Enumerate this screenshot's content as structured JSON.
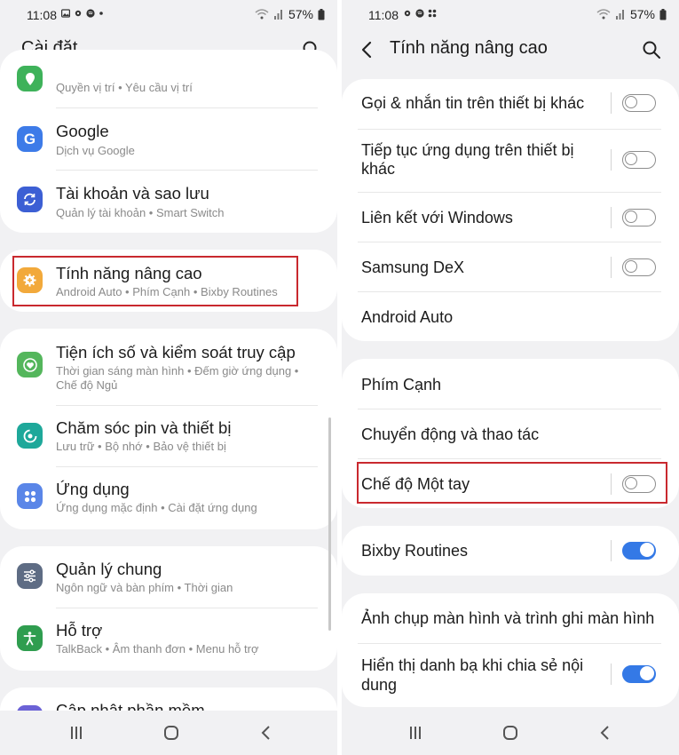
{
  "status_bar": {
    "left_time": "11:08",
    "right_time": "11:08",
    "battery": "57%"
  },
  "left": {
    "header_title": "Cài đặt",
    "cards": [
      {
        "rows": [
          {
            "title": "",
            "subtitle": "Quyền vị trí  •  Yêu cầu vị trí",
            "icon": "location-icon",
            "color": "#3eb25a"
          },
          {
            "title": "Google",
            "subtitle": "Dịch vụ Google",
            "icon": "google-icon",
            "color": "#3d7be8"
          },
          {
            "title": "Tài khoản và sao lưu",
            "subtitle": "Quản lý tài khoản  •  Smart Switch",
            "icon": "sync-icon",
            "color": "#3c5fd4"
          }
        ]
      },
      {
        "rows": [
          {
            "title": "Tính năng nâng cao",
            "subtitle": "Android Auto  •  Phím Cạnh  •  Bixby Routines",
            "icon": "gear-plus-icon",
            "color": "#f2a93b"
          }
        ]
      },
      {
        "rows": [
          {
            "title": "Tiện ích số và kiểm soát truy cập",
            "subtitle": "Thời gian sáng màn hình  •  Đếm giờ ứng dụng  •",
            "subtitle2": "Chế độ Ngủ",
            "icon": "heart-circle-icon",
            "color": "#54b65c"
          },
          {
            "title": "Chăm sóc pin và thiết bị",
            "subtitle": "Lưu trữ  •  Bộ nhớ  •  Bảo vệ thiết bị",
            "icon": "device-care-icon",
            "color": "#1ea89a"
          },
          {
            "title": "Ứng dụng",
            "subtitle": "Ứng dụng mặc định  •  Cài đặt ứng dụng",
            "icon": "apps-icon",
            "color": "#5a86e8"
          }
        ]
      },
      {
        "rows": [
          {
            "title": "Quản lý chung",
            "subtitle": "Ngôn ngữ và bàn phím  •  Thời gian",
            "icon": "sliders-icon",
            "color": "#5e6c84"
          },
          {
            "title": "Hỗ trợ",
            "subtitle": "TalkBack  •  Âm thanh đơn  •  Menu hỗ trợ",
            "icon": "accessibility-icon",
            "color": "#2f9d4f"
          }
        ]
      },
      {
        "rows": [
          {
            "title": "Cập nhật phần mềm",
            "subtitle": "",
            "icon": "update-icon",
            "color": "#6b62d6"
          }
        ]
      }
    ]
  },
  "right": {
    "header_title": "Tính năng nâng cao",
    "cards": [
      {
        "rows": [
          {
            "title": "Gọi & nhắn tin trên thiết bị khác",
            "toggle": "off"
          },
          {
            "title": "Tiếp tục ứng dụng trên thiết bị",
            "title2": "khác",
            "toggle": "off"
          },
          {
            "title": "Liên kết với Windows",
            "toggle": "off"
          },
          {
            "title": "Samsung DeX",
            "toggle": "off"
          },
          {
            "title": "Android Auto",
            "toggle": "none"
          }
        ]
      },
      {
        "rows": [
          {
            "title": "Phím Cạnh",
            "toggle": "none"
          },
          {
            "title": "Chuyển động và thao tác",
            "toggle": "none"
          },
          {
            "title": "Chế độ Một tay",
            "toggle": "off"
          }
        ]
      },
      {
        "rows": [
          {
            "title": "Bixby Routines",
            "toggle": "on"
          }
        ]
      },
      {
        "rows": [
          {
            "title": "Ảnh chụp màn hình và trình ghi màn hình",
            "toggle": "none"
          },
          {
            "title": "Hiển thị danh bạ khi chia sẻ nội",
            "title2": "dung",
            "toggle": "on"
          }
        ]
      }
    ]
  },
  "colors": {
    "highlight": "#c9292f",
    "toggle_on": "#3479e6",
    "background": "#f1f1f3"
  }
}
